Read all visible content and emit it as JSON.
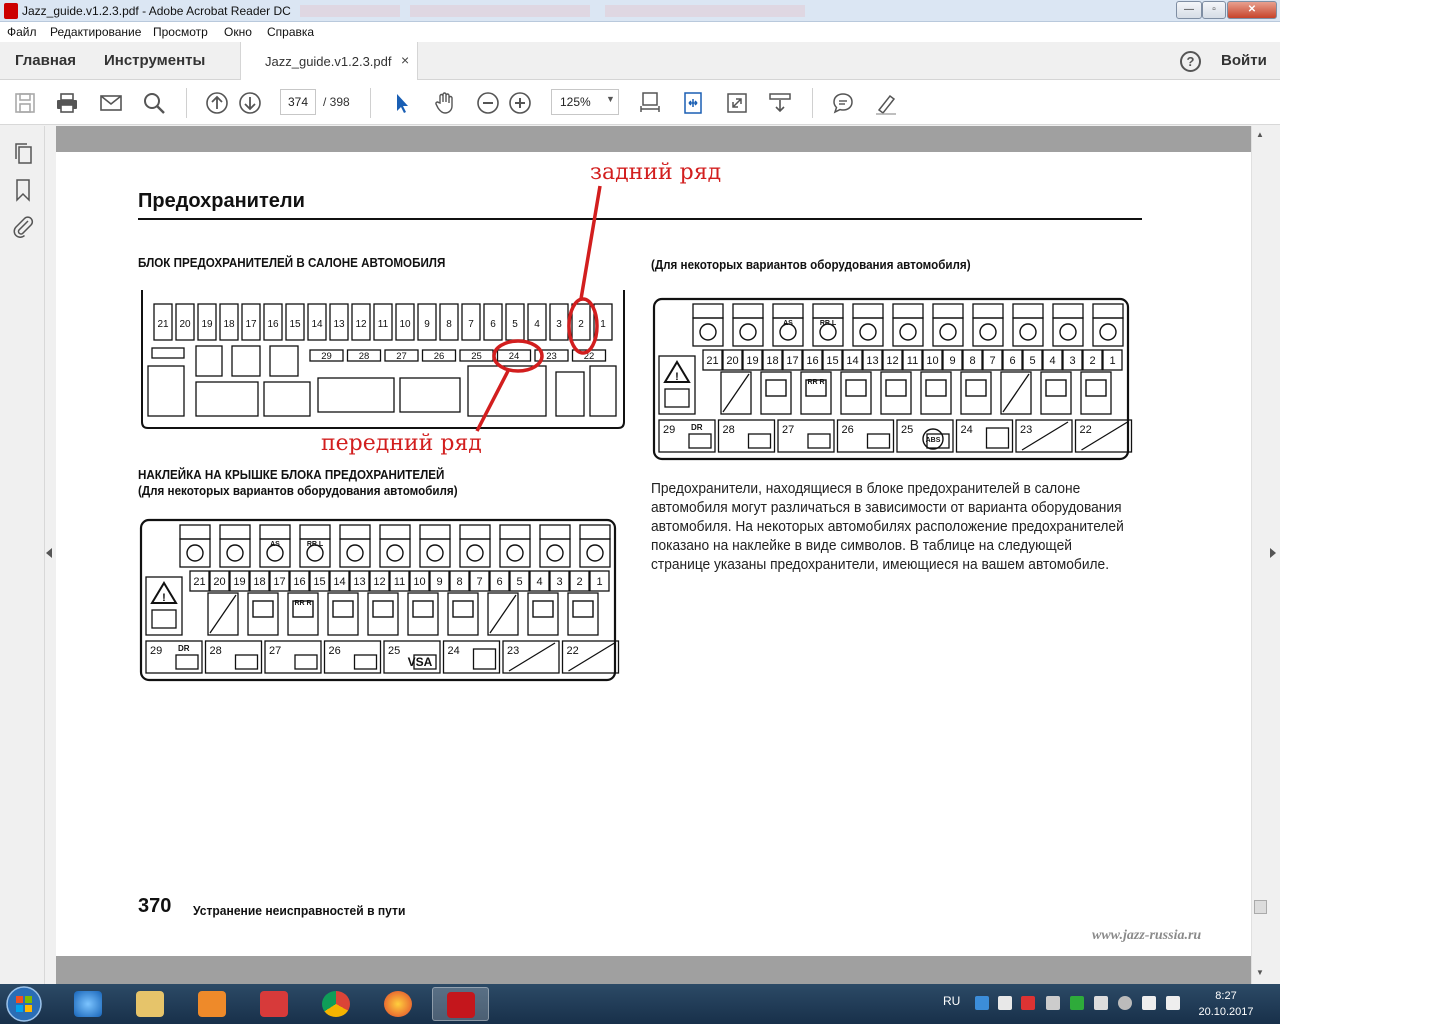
{
  "window": {
    "title": "Jazz_guide.v1.2.3.pdf - Adobe Acrobat Reader DC",
    "min": "—",
    "max": "▫",
    "close": "✕"
  },
  "menu": [
    "Файл",
    "Редактирование",
    "Просмотр",
    "Окно",
    "Справка"
  ],
  "tabs": {
    "home": "Главная",
    "tools": "Инструменты",
    "doc": "Jazz_guide.v1.2.3.pdf",
    "close": "×"
  },
  "topright": {
    "help": "?",
    "login": "Войти"
  },
  "toolbar": {
    "page_current": "374",
    "page_total": "/  398",
    "zoom": "125%",
    "zoom_arrow": "▼"
  },
  "page": {
    "title": "Предохранители",
    "caption_interior": "БЛОК ПРЕДОХРАНИТЕЛЕЙ В САЛОНЕ АВТОМОБИЛЯ",
    "caption_sticker": "НАКЛЕЙКА НА КРЫШКЕ БЛОКА ПРЕДОХРАНИТЕЛЕЙ",
    "caption_variant": "(Для некоторых вариантов оборудования автомобиля)",
    "caption_variant_right": "(Для некоторых вариантов оборудования автомобиля)",
    "body": "Предохранители, находящиеся в блоке предохранителей в салоне автомобиля могут различаться в зависимости от варианта оборудования автомобиля. На некоторых автомобилях расположение предохранителей показано на наклейке в виде символов. В таблице на следующей странице указаны предохранители, имеющиеся на вашем автомобиле.",
    "page_number": "370",
    "section": "Устранение неисправностей в пути",
    "url": "www.jazz-russia.ru"
  },
  "annotations": {
    "rear_row": "задний ряд",
    "front_row": "передний ряд"
  },
  "fuse_block": {
    "top_row": [
      "21",
      "20",
      "19",
      "18",
      "17",
      "16",
      "15",
      "14",
      "13",
      "12",
      "11",
      "10",
      "9",
      "8",
      "7",
      "6",
      "5",
      "4",
      "3",
      "2",
      "1"
    ],
    "second_row": [
      "29",
      "28",
      "27",
      "26",
      "25",
      "24",
      "23",
      "22"
    ]
  },
  "sticker": {
    "row_numbers": [
      "21",
      "20",
      "19",
      "18",
      "17",
      "16",
      "15",
      "14",
      "13",
      "12",
      "11",
      "10",
      "9",
      "8",
      "7",
      "6",
      "5",
      "4",
      "3",
      "2",
      "1"
    ],
    "bottom_numbers": [
      "29",
      "28",
      "27",
      "26",
      "25",
      "24",
      "23",
      "22"
    ],
    "bottom_tags": [
      "DR",
      "",
      "",
      "",
      "",
      "",
      "",
      ""
    ],
    "label_as": "AS",
    "label_rr_l": "RR  L",
    "label_rr_r": "RR  R",
    "label_vsa": "VSA",
    "label_abs": "ABS"
  },
  "taskbar": {
    "lang": "RU",
    "time": "8:27",
    "date": "20.10.2017"
  }
}
